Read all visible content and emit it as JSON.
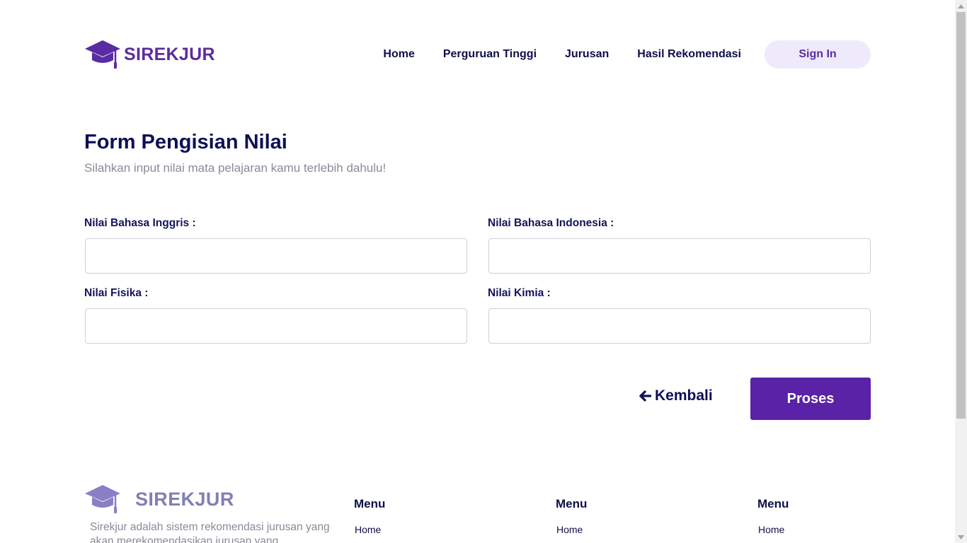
{
  "header": {
    "logo_text": "SIREKJUR",
    "nav": [
      "Home",
      "Perguruan Tinggi",
      "Jurusan",
      "Hasil Rekomendasi"
    ],
    "signin_label": "Sign In"
  },
  "form": {
    "title": "Form Pengisian Nilai",
    "subtitle": "Silahkan input nilai mata pelajaran kamu terlebih dahulu!",
    "fields": [
      {
        "label": "Nilai Bahasa Inggris :",
        "value": ""
      },
      {
        "label": "Nilai Bahasa Indonesia :",
        "value": ""
      },
      {
        "label": "Nilai Fisika :",
        "value": ""
      },
      {
        "label": "Nilai Kimia :",
        "value": ""
      }
    ],
    "back_label": "Kembali",
    "submit_label": "Proses"
  },
  "footer": {
    "logo_text": "SIREKJUR",
    "description": "Sirekjur adalah sistem rekomendasi jurusan yang akan merekomendasikan jurusan yang",
    "columns": [
      {
        "title": "Menu",
        "first_link": "Home"
      },
      {
        "title": "Menu",
        "first_link": "Home"
      },
      {
        "title": "Menu",
        "first_link": "Home"
      }
    ]
  },
  "colors": {
    "brand": "#5b2ba3",
    "primary_button": "#5a22a6",
    "signin_bg": "#efeafb",
    "heading": "#0f0f55"
  }
}
